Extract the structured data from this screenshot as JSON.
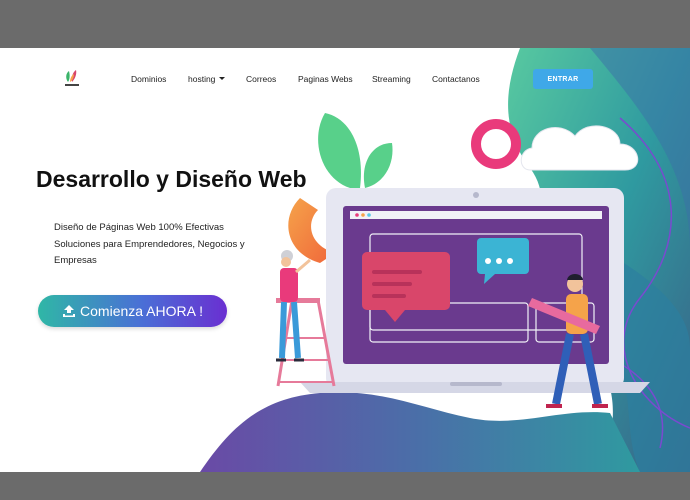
{
  "nav": {
    "items": [
      {
        "label": "Dominios"
      },
      {
        "label": "hosting"
      },
      {
        "label": "Correos"
      },
      {
        "label": "Paginas Webs"
      },
      {
        "label": "Streaming"
      },
      {
        "label": "Contactanos"
      }
    ],
    "login_label": "ENTRAR"
  },
  "hero": {
    "title_regular": "Desarrollo y ",
    "title_bold": "Diseño Web",
    "description": "Diseño de Páginas Web 100% Efectivas Soluciones para Emprendedores, Negocios y Empresas",
    "cta_label": "Comienza AHORA !"
  },
  "colors": {
    "accent": "#3fa8e8",
    "cta_start": "#2fb7a6",
    "cta_end": "#6a2fd1",
    "laptop_screen": "#6a3a8e",
    "chat_bubble": "#d9466a"
  },
  "icons": {
    "cta": "upload-icon",
    "logo": "brand-logo"
  }
}
